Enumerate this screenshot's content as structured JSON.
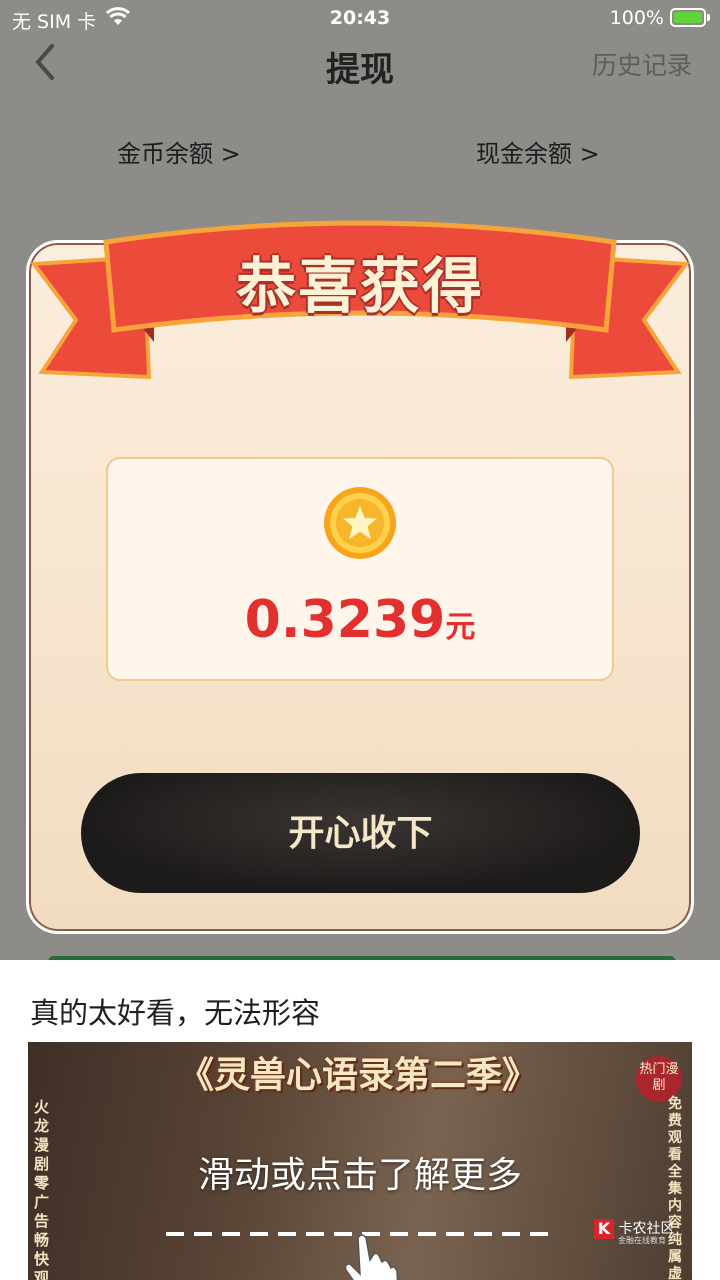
{
  "status_bar": {
    "carrier": "无 SIM 卡",
    "time": "20:43",
    "battery": "100%"
  },
  "nav": {
    "title": "提现",
    "history": "历史记录"
  },
  "balances": {
    "coin": "金币余额 >",
    "cash": "现金余额 >"
  },
  "modal": {
    "ribbon_title": "恭喜获得",
    "amount": "0.3239",
    "unit": "元",
    "accept_label": "开心收下"
  },
  "feed": {
    "caption": "真的太好看，无法形容",
    "video_title": "《灵兽心语录第二季》",
    "badge": "热门漫剧",
    "side_left": "火龙漫剧零广告 畅快观",
    "side_right": "免费观看全集 内容纯属虚构",
    "swipe_hint": "滑动或点击了解更多",
    "watermark": "卡农社区",
    "watermark_sub": "金融在线教育"
  },
  "colors": {
    "accent_red": "#e3302e",
    "button_dark": "#1d1b1a",
    "ribbon": "#ec4a3b"
  }
}
